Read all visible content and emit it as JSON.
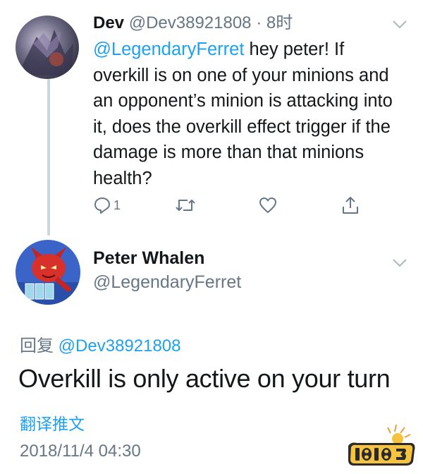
{
  "tweet": {
    "author_name": "Dev",
    "author_handle": "@Dev38921808",
    "separator": "·",
    "time_ago": "8时",
    "mention": "@LegendaryFerret",
    "text": " hey peter! If overkill is on one of your minions and an opponent’s minion is attacking into it, does the overkill effect trigger if the damage is more than that minions health?",
    "reply_count": "1"
  },
  "reply": {
    "author_name": "Peter Whalen",
    "author_handle": "@LegendaryFerret",
    "reply_prefix": "回复",
    "reply_to": "@Dev38921808",
    "text": "Overkill is only active on your turn",
    "translate_label": "翻译推文",
    "timestamp": "2018/11/4 04:30"
  },
  "watermark": {
    "text": "18183"
  },
  "colors": {
    "accent": "#1da1f2",
    "muted": "#657786",
    "text": "#14171a",
    "thread_line": "#ccd6dd"
  },
  "icons": [
    "chevron-down-icon",
    "reply-icon",
    "retweet-icon",
    "like-icon",
    "share-icon"
  ]
}
